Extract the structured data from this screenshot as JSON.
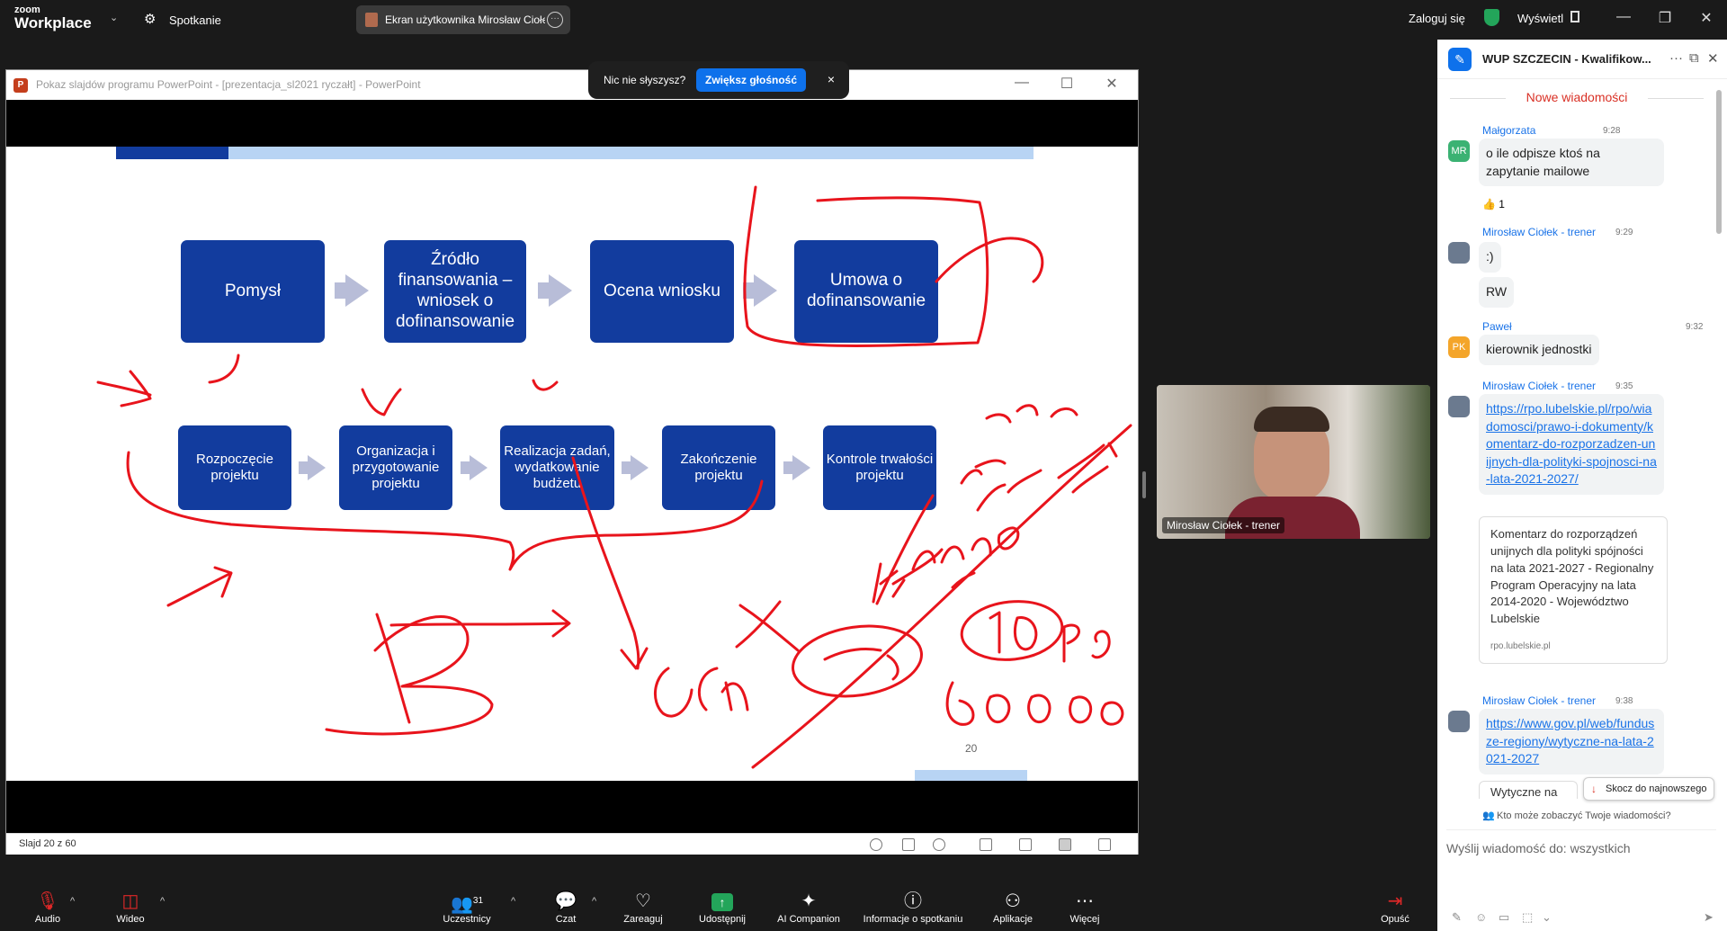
{
  "topbar": {
    "logo_line1": "zoom",
    "logo_line2": "Workplace",
    "meeting_label": "Spotkanie",
    "share_tab": "Ekran użytkownika Mirosław Ciołek",
    "sign_in": "Zaloguj się",
    "view": "Wyświetl"
  },
  "ppt": {
    "title": "Pokaz slajdów programu PowerPoint - [prezentacja_sl2021 ryczałt] - PowerPoint",
    "status": "Slajd 20 z 60",
    "slide_number": "20",
    "row1": [
      "Pomysł",
      "Źródło finansowania – wniosek o dofinansowanie",
      "Ocena wniosku",
      "Umowa o dofinansowanie"
    ],
    "row2": [
      "Rozpoczęcie projektu",
      "Organizacja i przygotowanie projektu",
      "Realizacja zadań, wydatkowanie budżetu",
      "Zakończenie projektu",
      "Kontrole trwałości projektu"
    ]
  },
  "notification": {
    "text": "Nic nie słyszysz?",
    "button": "Zwiększ głośność",
    "close": "×"
  },
  "video": {
    "name": "Mirosław Ciołek - trener"
  },
  "chat": {
    "title": "WUP SZCZECIN - Kwalifikow...",
    "new_messages": "Nowe wiadomości",
    "messages": [
      {
        "sender": "Małgorzata",
        "time": "9:28",
        "initials": "MR",
        "text": "o ile odpisze ktoś na zapytanie mailowe",
        "reaction": "👍 1"
      },
      {
        "sender": "Mirosław Ciołek - trener",
        "time": "9:29",
        "text1": ":)",
        "text2": "RW"
      },
      {
        "sender": "Paweł",
        "time": "9:32",
        "initials": "PK",
        "text": "kierownik jednostki"
      },
      {
        "sender": "Mirosław Ciołek - trener",
        "time": "9:35",
        "link": "https://rpo.lubelskie.pl/rpo/wiadomosci/prawo-i-dokumenty/komentarz-do-rozporzadzen-unijnych-dla-polityki-spojnosci-na-lata-2021-2027/",
        "preview": "Komentarz do rozporządzeń unijnych dla polityki spójności na lata 2021-2027 - Regionalny Program Operacyjny na lata 2014-2020 - Województwo Lubelskie",
        "preview_domain": "rpo.lubelskie.pl"
      },
      {
        "sender": "Mirosław Ciołek - trener",
        "time": "9:38",
        "link": "https://www.gov.pl/web/fundusze-regiony/wytyczne-na-lata-2021-2027",
        "preview_start": "Wytyczne na lata"
      }
    ],
    "jump": "Skocz do najnowszego",
    "privacy": "Kto może zobaczyć Twoje wiadomości?",
    "placeholder": "Wyślij wiadomość do: wszystkich"
  },
  "toolbar": {
    "audio": "Audio",
    "video": "Wideo",
    "participants": "Uczestnicy",
    "participants_count": "31",
    "chat": "Czat",
    "react": "Zareaguj",
    "share": "Udostępnij",
    "ai": "AI Companion",
    "info": "Informacje o spotkaniu",
    "apps": "Aplikacje",
    "more": "Więcej",
    "leave": "Opuść"
  },
  "colors": {
    "accent": "#0e71eb",
    "slide_box": "#123c9e",
    "annotation": "#e8141c",
    "leave": "#e02828"
  }
}
